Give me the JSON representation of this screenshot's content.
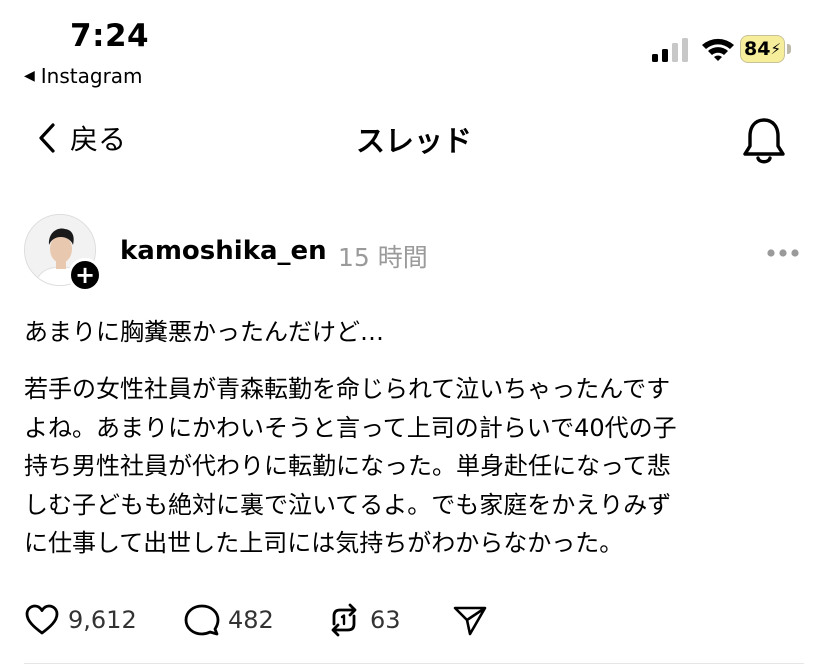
{
  "status_bar": {
    "time": "7:24",
    "back_app": "Instagram",
    "battery": "84"
  },
  "nav": {
    "back_label": "戻る",
    "title": "スレッド"
  },
  "post": {
    "username": "kamoshika_en",
    "time": "15 時間",
    "first_line": "あまりに胸糞悪かったんだけど…",
    "body_lines": [
      "若手の女性社員が青森転勤を命じられて泣いちゃったんです",
      "よね。あまりにかわいそうと言って上司の計らいで40代の子",
      "持ち男性社員が代わりに転勤になった。単身赴任になって悲",
      "しむ子どもも絶対に裏で泣いてるよ。でも家庭をかえりみず",
      "に仕事して出世した上司には気持ちがわからなかった。"
    ]
  },
  "actions": {
    "likes": "9,612",
    "comments": "482",
    "reposts": "63"
  },
  "icons": {
    "like": "heart-icon",
    "comment": "comment-icon",
    "repost": "repost-icon",
    "share": "send-icon",
    "notifications": "bell-icon",
    "more": "more-icon"
  }
}
